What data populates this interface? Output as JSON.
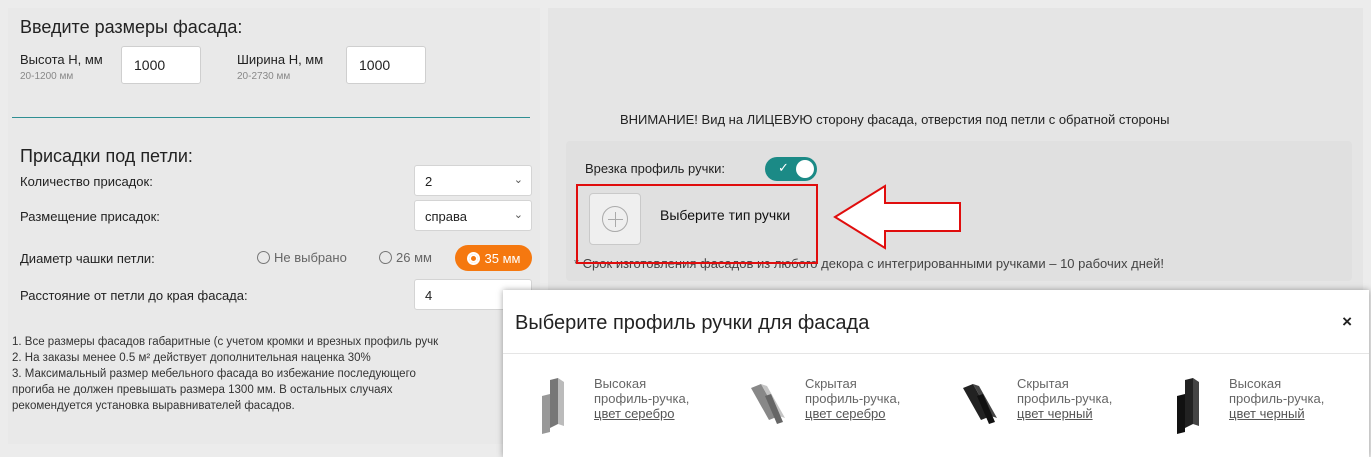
{
  "form": {
    "title": "Введите размеры фасада:",
    "height": {
      "label": "Высота H, мм",
      "hint": "20-1200 мм",
      "value": "1000"
    },
    "width": {
      "label": "Ширина H, мм",
      "hint": "20-2730 мм",
      "value": "1000"
    }
  },
  "hinges": {
    "title": "Присадки под петли:",
    "count": {
      "label": "Количество присадок:",
      "value": "2"
    },
    "placement": {
      "label": "Размещение присадок:",
      "value": "справа"
    },
    "diameter": {
      "label": "Диаметр чашки петли:",
      "options": [
        "Не выбрано",
        "26 мм",
        "35 мм"
      ],
      "selected": "35 мм"
    },
    "distance": {
      "label": "Расстояние от петли до края фасада:",
      "value": "4"
    }
  },
  "notes": [
    "1. Все размеры фасадов габаритные (с учетом кромки и врезных профиль ручк",
    "2. На заказы менее 0.5 м² действует дополнительная наценка 30%",
    "3. Максимальный размер мебельного фасада во избежание последующего",
    "прогиба не должен превышать размера 1300 мм. В остальных случаях",
    "рекомендуется установка выравнивателей фасадов."
  ],
  "warning": "ВНИМАНИЕ! Вид на ЛИЦЕВУЮ сторону фасада, отверстия под петли с обратной стороны",
  "handle": {
    "toggle_label": "Врезка профиль ручки:",
    "toggle_on": true,
    "choose_label": "Выберите тип ручки",
    "deadline": "* Срок изготовления фасадов из любого декора с интегрированными ручками – 10 рабочих дней!"
  },
  "modal": {
    "title": "Выберите профиль ручки для фасада",
    "close": "×",
    "products": [
      {
        "line1": "Высокая",
        "line2": "профиль-ручка,",
        "link": "цвет серебро",
        "color": "silver"
      },
      {
        "line1": "Скрытая",
        "line2": "профиль-ручка,",
        "link": "цвет серебро",
        "color": "silver"
      },
      {
        "line1": "Скрытая",
        "line2": "профиль-ручка,",
        "link": "цвет черный",
        "color": "black"
      },
      {
        "line1": "Высокая",
        "line2": "профиль-ручка,",
        "link": "цвет черный",
        "color": "black"
      }
    ]
  },
  "colors": {
    "accent": "#1b8a86",
    "selected": "#f5780f",
    "highlight": "#e00d0d"
  }
}
